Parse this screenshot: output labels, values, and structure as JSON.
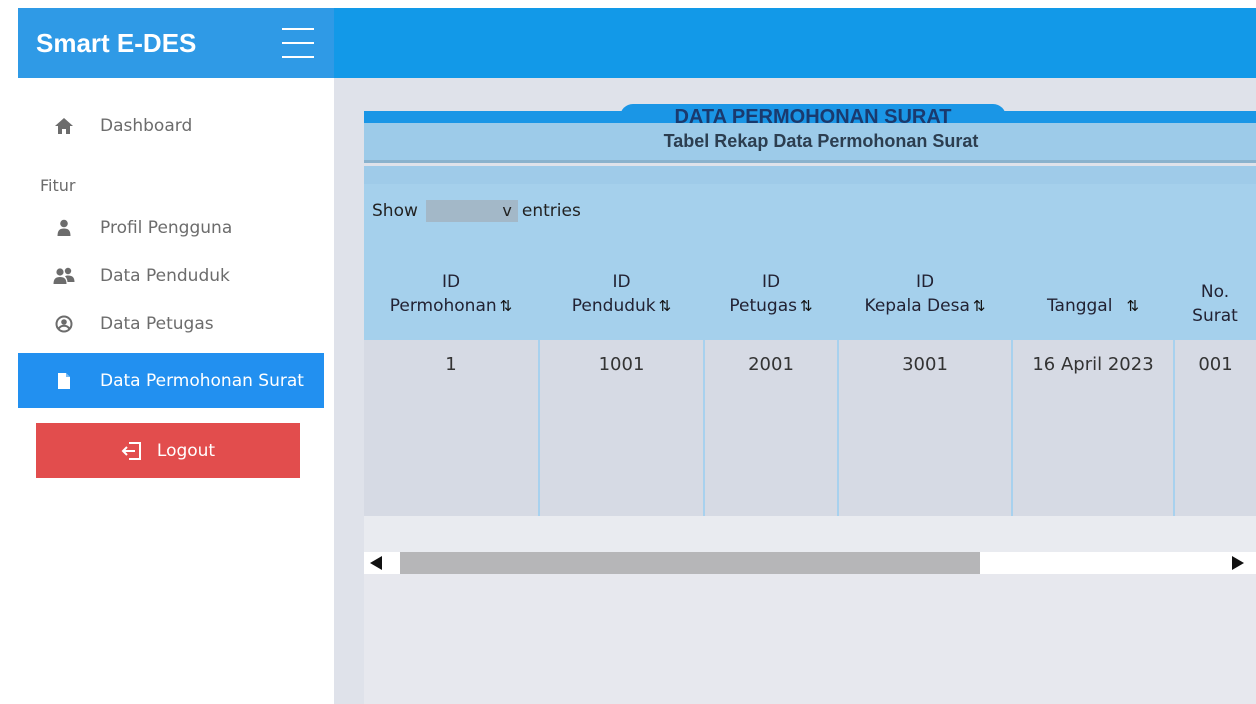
{
  "app": {
    "brand_title": "Smart E-DES"
  },
  "sidebar": {
    "dashboard_label": "Dashboard",
    "section_label": "Fitur",
    "items": [
      {
        "label": "Profil Pengguna",
        "icon": "user-icon"
      },
      {
        "label": "Data Penduduk",
        "icon": "users-icon"
      },
      {
        "label": "Data Petugas",
        "icon": "user-circle-icon"
      },
      {
        "label": "Data Permohonan Surat",
        "icon": "document-icon",
        "active": true
      }
    ],
    "logout_label": "Logout"
  },
  "main": {
    "title": "DATA PERMOHONAN SURAT",
    "subtitle": "Tabel Rekap Data Permohonan Surat",
    "show_label": "Show",
    "select_caret": "v",
    "entries_label": "entries",
    "sort_glyph": "⇅",
    "columns": [
      {
        "line1": "ID",
        "line2": "Permohonan"
      },
      {
        "line1": "ID",
        "line2": "Penduduk"
      },
      {
        "line1": "ID",
        "line2": "Petugas"
      },
      {
        "line1": "ID",
        "line2": "Kepala Desa"
      },
      {
        "line1": "",
        "line2": "Tanggal"
      },
      {
        "line1": "No.",
        "line2": "Surat"
      }
    ],
    "rows": [
      [
        "1",
        "1001",
        "2001",
        "3001",
        "16 April 2023",
        "001"
      ]
    ]
  },
  "colors": {
    "brand_bg": "#2f9ae6",
    "topbar_bg": "#1299e8",
    "active_item_bg": "#2290f0",
    "logout_bg": "#e24d4d",
    "table_header_bg": "#a5d0ec",
    "main_bg": "#dfe2ea"
  }
}
